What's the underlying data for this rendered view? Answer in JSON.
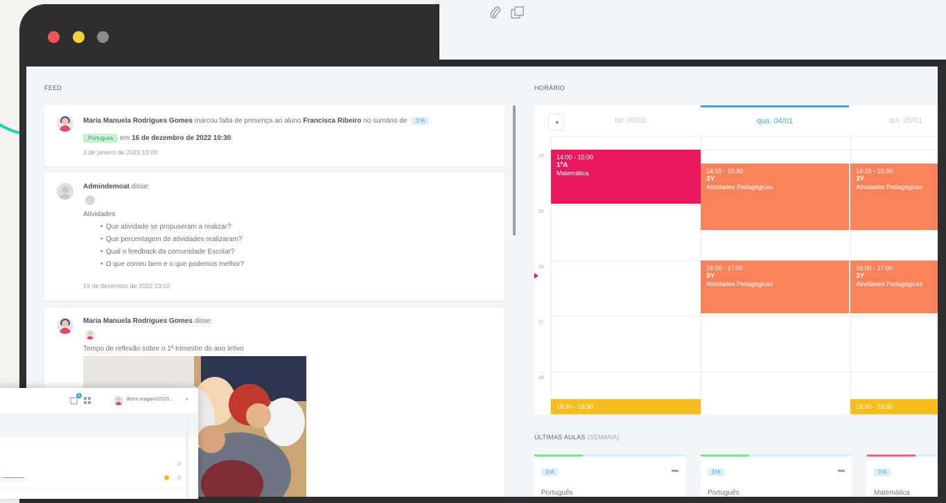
{
  "window": {
    "controls": [
      "close",
      "minimize",
      "maximize"
    ]
  },
  "top_window": {
    "icons": [
      "paperclip-icon",
      "copy-icon"
    ]
  },
  "feed": {
    "title": "FEED",
    "posts": [
      {
        "author": "Maria Manuela Rodrigues Gomes",
        "action": "marcou falta de presença ao aluno",
        "target": "Francisca Ribeiro",
        "suffix": "no sumário de",
        "badge": "1ºA",
        "status": "Portugues",
        "date_prefix": "em",
        "date": "16 de dezembro de 2022 10:30",
        "timestamp": "3 de janeiro de 2023 13:00"
      },
      {
        "author": "Admindemoat",
        "verb": "disse:",
        "heading": "Atividades",
        "items": [
          "Que atividade se propuseram a realizar?",
          "Que percentagem de atividades realizaram?",
          "Qual o feedback da comunidade Escolar?",
          "O que correu bem e o que podemos melhor?"
        ],
        "timestamp": "16 de dezembro de 2022 13:02"
      },
      {
        "author": "Maria Manuela Rodrigues Gomes",
        "verb": "disse:",
        "body": "Tempo de reflexão sobre o 1º trimestre do ano letivo"
      }
    ]
  },
  "schedule": {
    "title": "HORÁRIO",
    "prev_label": "◂",
    "days": [
      "ter. 03/01",
      "qua. 04/01",
      "qui. 05/01"
    ],
    "active_day_index": 1,
    "hours": [
      "14",
      "15",
      "16",
      "17",
      "18"
    ],
    "events": [
      {
        "time": "14:00 - 15:00",
        "class": "1ºA",
        "subject": "Matemática",
        "color": "#e8195f"
      },
      {
        "time": "14:15 - 15:30",
        "class": "3Y",
        "subject": "Atividades Pedagógicas",
        "color": "#fa825a"
      },
      {
        "time": "14:15 - 15:30",
        "class": "3Y",
        "subject": "Atividades Pedagógicas",
        "color": "#fa825a"
      },
      {
        "time": "16:00 - 17:00",
        "class": "3Y",
        "subject": "Atividades Pedagógicas",
        "color": "#fa825a"
      },
      {
        "time": "16:00 - 17:00",
        "class": "3Y",
        "subject": "Atividades Pedagógicas",
        "color": "#fa825a"
      },
      {
        "time": "18:30 - 19:30",
        "color": "#f8bd1c"
      },
      {
        "time": "18:30 - 19:30",
        "color": "#f8bd1c"
      }
    ]
  },
  "last_lessons": {
    "title": "ÚLTIMAS AULAS",
    "subtitle": "(SEMANA)",
    "cards": [
      {
        "badge": "1ºA",
        "subject": "Português",
        "bar_color": "#7be495"
      },
      {
        "badge": "1ºA",
        "subject": "Português",
        "bar_color": "#7be495"
      },
      {
        "badge": "1ºA",
        "subject": "Matemática",
        "bar_color": "#f2637e"
      }
    ]
  },
  "bottom_window": {
    "user_label": "demo.oraganiz2023...",
    "notification_count": "1"
  },
  "colors": {
    "accent": "#4aa3d8",
    "teal": "#19d3b5"
  }
}
